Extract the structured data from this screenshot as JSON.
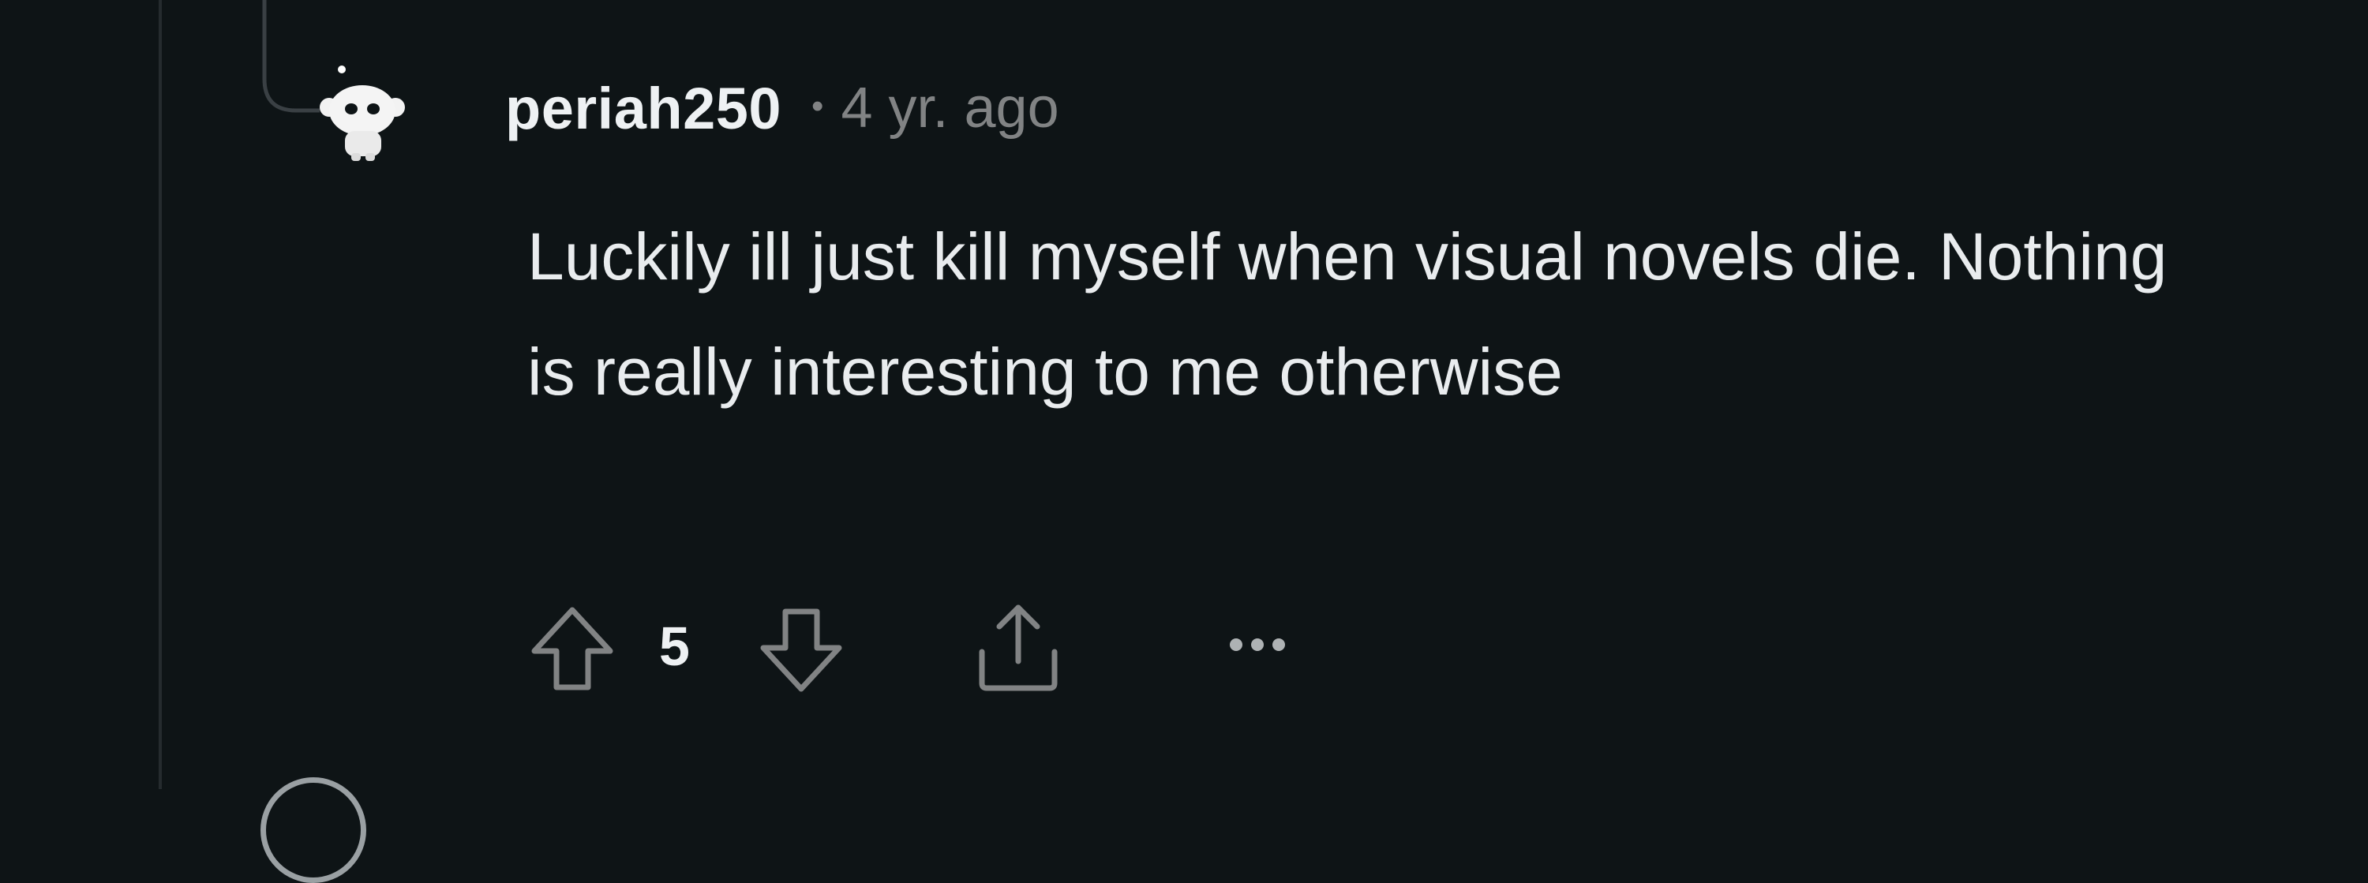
{
  "comment": {
    "author": "periah250",
    "separator": "•",
    "timestamp": "4 yr. ago",
    "body": "Luckily ill just kill myself when visual novels die. Nothing is really interesting to me otherwise",
    "vote_count": "5"
  },
  "icons": {
    "avatar": "snoo-avatar-icon",
    "upvote": "upvote-arrow-icon",
    "downvote": "downvote-arrow-icon",
    "share": "share-icon",
    "more": "more-options-icon"
  },
  "colors": {
    "background": "#0e1416",
    "author": "#eef1f3",
    "meta_text": "#818384",
    "body_text": "#e9ecee",
    "icon": "#818384",
    "thread_line": "#252b2e"
  }
}
